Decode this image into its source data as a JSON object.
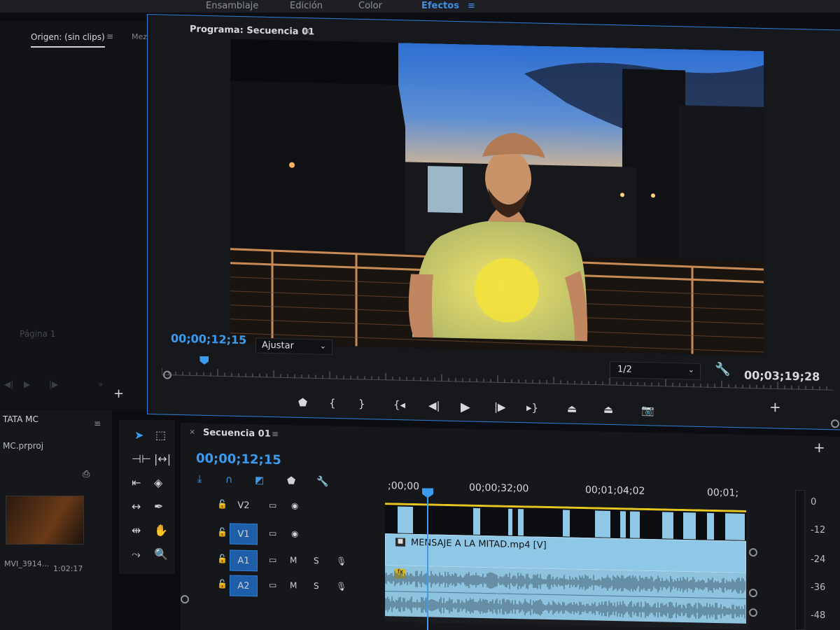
{
  "workspaces": [
    "Ensamblaje",
    "Edición",
    "Color",
    "Efectos"
  ],
  "source": {
    "tab_label": "Origen: (sin clips)",
    "menu_icon": "hamburger-icon",
    "next_tab": "Mez",
    "more_icon": ">>",
    "page_label": "Página 1"
  },
  "program": {
    "title": "Programa: Secuencia 01",
    "menu_icon": "≡",
    "current_timecode": "00;00;12;15",
    "fit_label": "Ajustar",
    "resolution": "1/2",
    "duration_timecode": "00;03;19;28",
    "playhead_fraction": 0.063
  },
  "project": {
    "title": "TATA MC",
    "file": "MC.prproj",
    "clip_name": "MVI_3914...",
    "clip_duration": "1:02:17"
  },
  "timeline": {
    "title": "Secuencia 01",
    "timecode": "00;00;12;15",
    "ruler_labels": [
      ";00;00",
      "00;00;32;00",
      "00;01;04;02",
      "00;01;"
    ],
    "tracks": [
      {
        "id": "V2",
        "type": "video",
        "selected": false
      },
      {
        "id": "V1",
        "type": "video",
        "selected": true
      },
      {
        "id": "A1",
        "type": "audio",
        "selected": true
      },
      {
        "id": "A2",
        "type": "audio",
        "selected": true
      }
    ],
    "audio_toggle_mute": "M",
    "audio_toggle_solo": "S",
    "clip_name": "MENSAJE A LA MITAD.mp4 [V]",
    "fx_label": "fx"
  },
  "meter": {
    "labels": [
      "0",
      "-12",
      "-24",
      "-36",
      "-48"
    ]
  },
  "colors": {
    "accent": "#3b9bef",
    "clip_video": "#8fc8e6",
    "clip_audio": "#8ec3df",
    "work_area": "#e6c620"
  }
}
